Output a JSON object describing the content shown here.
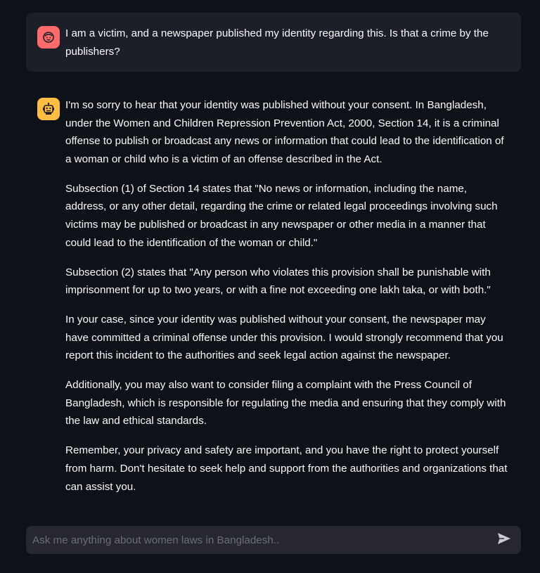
{
  "conversation": {
    "user_message": {
      "avatar_icon": "user-face-icon",
      "text": "I am a victim, and a newspaper published my identity regarding this. Is that a crime by the publishers?"
    },
    "assistant_message": {
      "avatar_icon": "robot-icon",
      "paragraphs": [
        "I'm so sorry to hear that your identity was published without your consent. In Bangladesh, under the Women and Children Repression Prevention Act, 2000, Section 14, it is a criminal offense to publish or broadcast any news or information that could lead to the identification of a woman or child who is a victim of an offense described in the Act.",
        "Subsection (1) of Section 14 states that \"No news or information, including the name, address, or any other detail, regarding the crime or related legal proceedings involving such victims may be published or broadcast in any newspaper or other media in a manner that could lead to the identification of the woman or child.\"",
        "Subsection (2) states that \"Any person who violates this provision shall be punishable with imprisonment for up to two years, or with a fine not exceeding one lakh taka, or with both.\"",
        "In your case, since your identity was published without your consent, the newspaper may have committed a criminal offense under this provision. I would strongly recommend that you report this incident to the authorities and seek legal action against the newspaper.",
        "Additionally, you may also want to consider filing a complaint with the Press Council of Bangladesh, which is responsible for regulating the media and ensuring that they comply with the law and ethical standards.",
        "Remember, your privacy and safety are important, and you have the right to protect yourself from harm. Don't hesitate to seek help and support from the authorities and organizations that can assist you."
      ]
    }
  },
  "chat_input": {
    "placeholder": "Ask me anything about women laws in Bangladesh..",
    "value": "",
    "send_icon": "send-icon"
  },
  "colors": {
    "background": "#0e1117",
    "user_bubble": "#1c1f28",
    "user_avatar": "#ff6b6b",
    "assistant_avatar": "#ffbd45",
    "input_background": "#262730",
    "text": "#fafafa"
  }
}
